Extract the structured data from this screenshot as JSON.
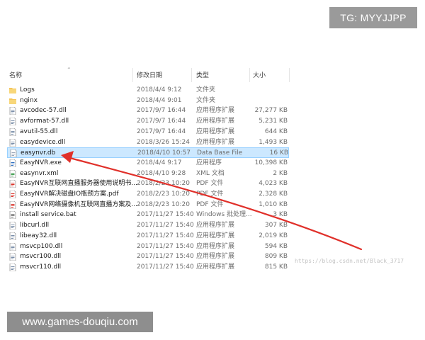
{
  "tg_badge": "TG: MYYJJPP",
  "header": {
    "name": "名称",
    "date": "修改日期",
    "type": "类型",
    "size": "大小"
  },
  "files": [
    {
      "name": "Logs",
      "date": "2018/4/4 9:12",
      "type": "文件夹",
      "size": "",
      "icon": "folder-icon"
    },
    {
      "name": "nginx",
      "date": "2018/4/4 9:01",
      "type": "文件夹",
      "size": "",
      "icon": "folder-icon"
    },
    {
      "name": "avcodec-57.dll",
      "date": "2017/9/7 16:44",
      "type": "应用程序扩展",
      "size": "27,277 KB",
      "icon": "dll-icon"
    },
    {
      "name": "avformat-57.dll",
      "date": "2017/9/7 16:44",
      "type": "应用程序扩展",
      "size": "5,231 KB",
      "icon": "dll-icon"
    },
    {
      "name": "avutil-55.dll",
      "date": "2017/9/7 16:44",
      "type": "应用程序扩展",
      "size": "644 KB",
      "icon": "dll-icon"
    },
    {
      "name": "easydevice.dll",
      "date": "2018/3/26 15:24",
      "type": "应用程序扩展",
      "size": "1,493 KB",
      "icon": "dll-icon"
    },
    {
      "name": "easynvr.db",
      "date": "2018/4/10 10:57",
      "type": "Data Base File",
      "size": "16 KB",
      "icon": "db-file-icon",
      "selected": true
    },
    {
      "name": "EasyNVR.exe",
      "date": "2018/4/4 9:17",
      "type": "应用程序",
      "size": "10,398 KB",
      "icon": "exe-icon"
    },
    {
      "name": "easynvr.xml",
      "date": "2018/4/10 9:28",
      "type": "XML 文档",
      "size": "2 KB",
      "icon": "xml-icon"
    },
    {
      "name": "EasyNVR互联网直播服务器使用说明书...",
      "date": "2018/2/23 10:20",
      "type": "PDF 文件",
      "size": "4,023 KB",
      "icon": "pdf-icon"
    },
    {
      "name": "EasyNVR解决磁盘IO瓶颈方案.pdf",
      "date": "2018/2/23 10:20",
      "type": "PDF 文件",
      "size": "2,328 KB",
      "icon": "pdf-icon"
    },
    {
      "name": "EasyNVR网络摄像机互联网直播方案及...",
      "date": "2018/2/23 10:20",
      "type": "PDF 文件",
      "size": "1,010 KB",
      "icon": "pdf-icon"
    },
    {
      "name": "install service.bat",
      "date": "2017/11/27 15:40",
      "type": "Windows 批处理...",
      "size": "3 KB",
      "icon": "bat-icon"
    },
    {
      "name": "libcurl.dll",
      "date": "2017/11/27 15:40",
      "type": "应用程序扩展",
      "size": "307 KB",
      "icon": "dll-icon"
    },
    {
      "name": "libeay32.dll",
      "date": "2017/11/27 15:40",
      "type": "应用程序扩展",
      "size": "2,019 KB",
      "icon": "dll-icon"
    },
    {
      "name": "msvcp100.dll",
      "date": "2017/11/27 15:40",
      "type": "应用程序扩展",
      "size": "594 KB",
      "icon": "dll-icon"
    },
    {
      "name": "msvcr100.dll",
      "date": "2017/11/27 15:40",
      "type": "应用程序扩展",
      "size": "809 KB",
      "icon": "dll-icon"
    },
    {
      "name": "msvcr110.dll",
      "date": "2017/11/27 15:40",
      "type": "应用程序扩展",
      "size": "815 KB",
      "icon": "dll-icon"
    }
  ],
  "watermark_blog": "https://blog.csdn.net/Black_3717",
  "site_badge": "www.games-douqiu.com",
  "colors": {
    "selection": "#cce8ff",
    "arrow": "#e0302a",
    "folder": "#f4c55a"
  }
}
